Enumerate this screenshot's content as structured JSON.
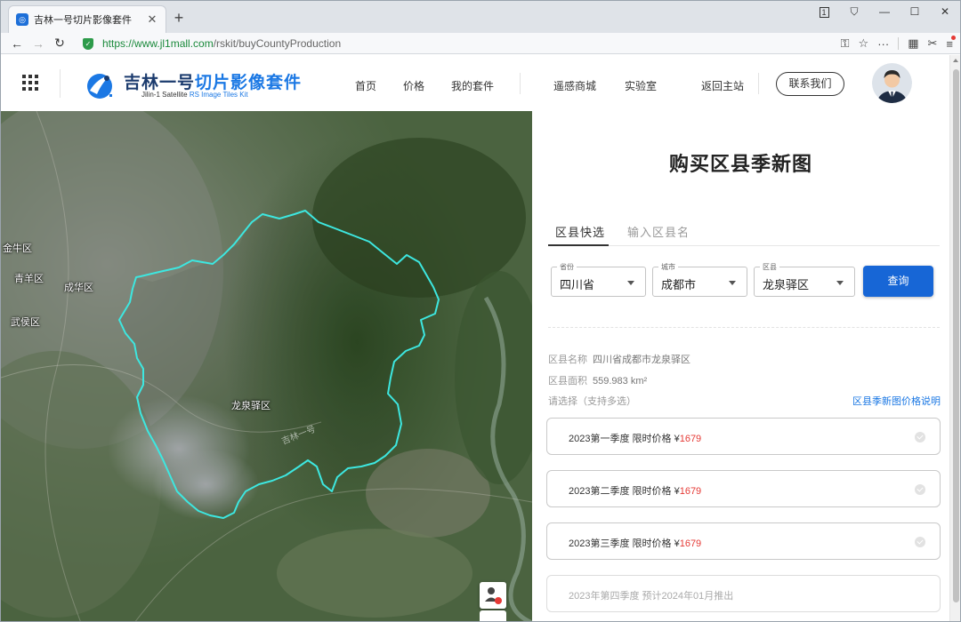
{
  "browser": {
    "tab_title": "吉林一号切片影像套件",
    "tab_favicon": "jilin-logo",
    "url_scheme": "https://",
    "url_host": "www.jl1mall.com",
    "url_path": "/rskit/buyCountyProduction",
    "winctrl_tab_count": "1"
  },
  "header": {
    "brand_title_main": "吉林一号",
    "brand_title_accent": "切片影像套件",
    "brand_sub_main": "Jilin-1 Satellite",
    "brand_sub_accent": "RS Image Tiles Kit",
    "nav": [
      "首页",
      "价格",
      "我的套件",
      "遥感商城",
      "实验室",
      "返回主站"
    ],
    "contact_label": "联系我们"
  },
  "map": {
    "labels": [
      "金牛区",
      "青羊区",
      "成华区",
      "武侯区",
      "龙泉驿区"
    ],
    "watermark": "吉林一号",
    "boundary_color": "#3de7e0"
  },
  "panel": {
    "title": "购买区县季新图",
    "tabs": [
      "区县快选",
      "输入区县名"
    ],
    "province": {
      "label": "省份",
      "value": "四川省"
    },
    "city": {
      "label": "城市",
      "value": "成都市"
    },
    "district": {
      "label": "区县",
      "value": "龙泉驿区"
    },
    "query_label": "查询",
    "name_label": "区县名称",
    "name_value": "四川省成都市龙泉驿区",
    "area_label": "区县面积",
    "area_value": "559.983  km²",
    "select_hint": "请选择（支持多选）",
    "price_link": "区县季新图价格说明",
    "seasons": [
      {
        "text": "2023第一季度 限时价格 ¥",
        "price": "1679"
      },
      {
        "text": "2023第二季度 限时价格 ¥",
        "price": "1679"
      },
      {
        "text": "2023第三季度 限时价格 ¥",
        "price": "1679"
      },
      {
        "text": "2023年第四季度 预计2024年01月推出",
        "price": ""
      }
    ],
    "accent_color": "#1766d6",
    "price_color": "#e53935"
  }
}
